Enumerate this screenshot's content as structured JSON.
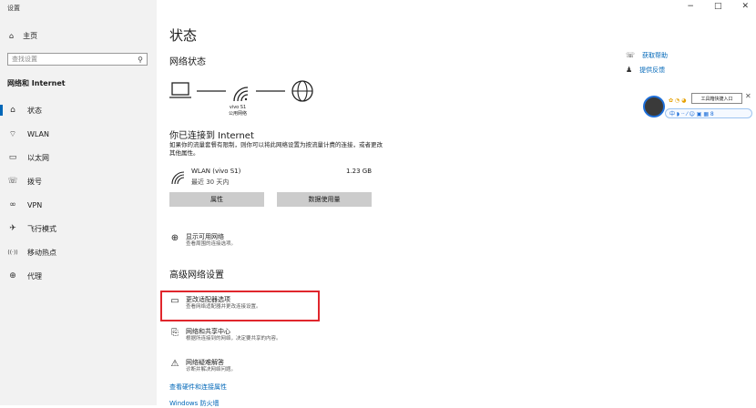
{
  "app": {
    "title": "设置"
  },
  "window_controls": {
    "minimize": "−",
    "maximize": "□",
    "close": "✕"
  },
  "sidebar": {
    "home": "主页",
    "search_placeholder": "查找设置",
    "section": "网络和 Internet",
    "items": [
      {
        "label": "状态",
        "icon": "home-status-icon",
        "glyph": "⌂"
      },
      {
        "label": "WLAN",
        "icon": "wifi-icon",
        "glyph": "⌔"
      },
      {
        "label": "以太网",
        "icon": "ethernet-icon",
        "glyph": "▭"
      },
      {
        "label": "拨号",
        "icon": "dialup-icon",
        "glyph": "☏"
      },
      {
        "label": "VPN",
        "icon": "vpn-icon",
        "glyph": "∞"
      },
      {
        "label": "飞行模式",
        "icon": "airplane-icon",
        "glyph": "✈"
      },
      {
        "label": "移动热点",
        "icon": "hotspot-icon",
        "glyph": "((·))"
      },
      {
        "label": "代理",
        "icon": "proxy-icon",
        "glyph": "⊕"
      }
    ]
  },
  "main": {
    "title": "状态",
    "net_status": "网络状态",
    "network_label_1": "vivo S1",
    "network_label_2": "公用网络",
    "connected": "你已连接到 Internet",
    "desc": "如果你的流量套餐有限制，则你可以将此网络设置为按流量计费的连接，或者更改其他属性。",
    "wlan": {
      "name": "WLAN (vivo S1)",
      "sub": "最近 30 天内",
      "size": "1.23 GB"
    },
    "buttons": {
      "properties": "属性",
      "data_usage": "数据使用量"
    },
    "show_networks": {
      "title": "显示可用网络",
      "sub": "查看周围的连接选项。"
    },
    "advanced": "高级网络设置",
    "adapter": {
      "title": "更改适配器选项",
      "sub": "查看网络适配器并更改连接设置。"
    },
    "sharing": {
      "title": "网络和共享中心",
      "sub": "根据所连接到的网络，决定要共享的内容。"
    },
    "troubleshoot": {
      "title": "网络疑难解答",
      "sub": "诊断并解决网络问题。"
    },
    "hw_link": "查看硬件和连接属性",
    "firewall_link": "Windows 防火墙"
  },
  "help": {
    "get_help": "获取帮助",
    "feedback": "提供反馈"
  },
  "widget": {
    "tooltip": "工具箱快捷入口",
    "bar": "中 ◗ ·· ⁄ ☺ ▣ ▦ 8"
  },
  "colors": {
    "accent": "#0067b8",
    "highlight": "#e0262c",
    "sidebar_bg": "#f2f2f2"
  }
}
